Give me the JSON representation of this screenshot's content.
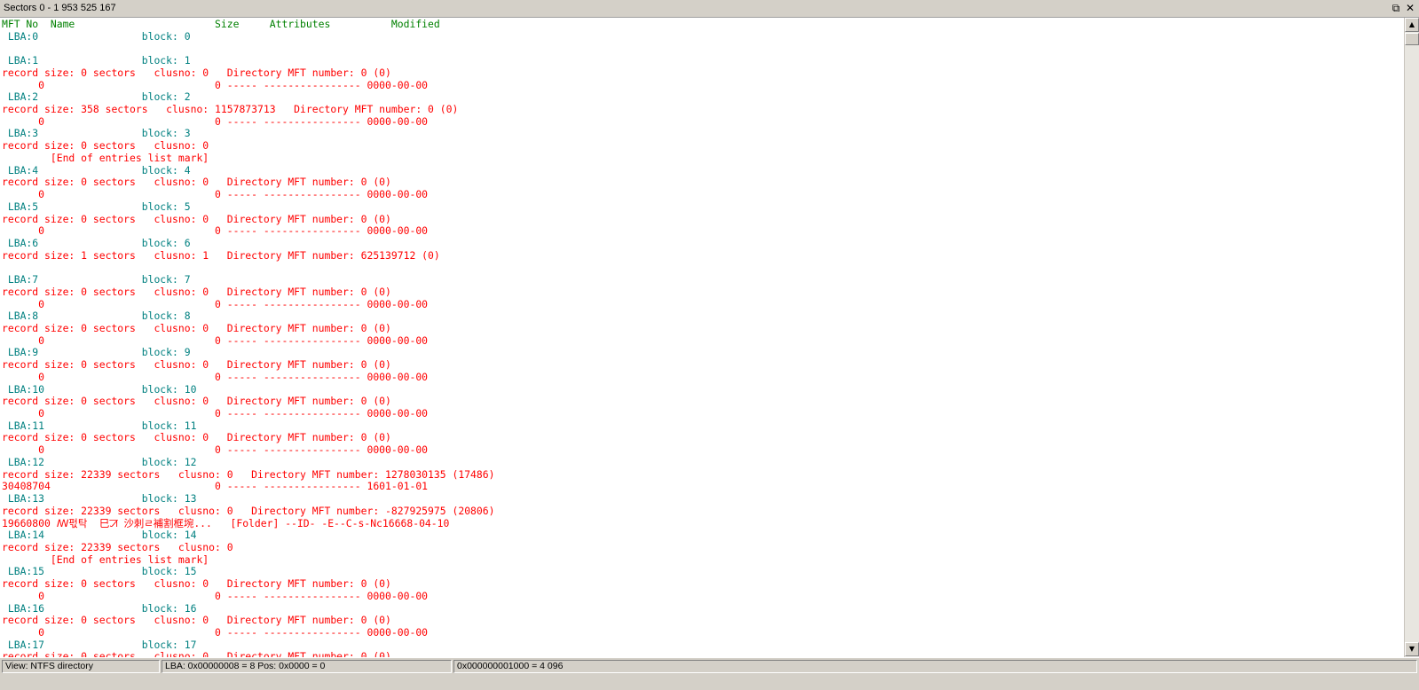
{
  "window": {
    "title": "Sectors 0 - 1 953 525 167",
    "restore_icon": "restore-icon",
    "close_icon": "close-icon"
  },
  "header": {
    "text": "MFT No  Name                       Size     Attributes          Modified"
  },
  "lines": [
    {
      "c": "lba",
      "t": " LBA:0                 block: 0"
    },
    {
      "c": "red",
      "t": ""
    },
    {
      "c": "lba",
      "t": " LBA:1                 block: 1"
    },
    {
      "c": "red",
      "t": "record size: 0 sectors   clusno: 0   Directory MFT number: 0 (0)"
    },
    {
      "c": "red",
      "t": "      0                            0 ----- ---------------- 0000-00-00"
    },
    {
      "c": "lba",
      "t": " LBA:2                 block: 2"
    },
    {
      "c": "red",
      "t": "record size: 358 sectors   clusno: 1157873713   Directory MFT number: 0 (0)"
    },
    {
      "c": "red",
      "t": "      0                            0 ----- ---------------- 0000-00-00"
    },
    {
      "c": "lba",
      "t": " LBA:3                 block: 3"
    },
    {
      "c": "red",
      "t": "record size: 0 sectors   clusno: 0"
    },
    {
      "c": "red",
      "t": "        [End of entries list mark]"
    },
    {
      "c": "lba",
      "t": " LBA:4                 block: 4"
    },
    {
      "c": "red",
      "t": "record size: 0 sectors   clusno: 0   Directory MFT number: 0 (0)"
    },
    {
      "c": "red",
      "t": "      0                            0 ----- ---------------- 0000-00-00"
    },
    {
      "c": "lba",
      "t": " LBA:5                 block: 5"
    },
    {
      "c": "red",
      "t": "record size: 0 sectors   clusno: 0   Directory MFT number: 0 (0)"
    },
    {
      "c": "red",
      "t": "      0                            0 ----- ---------------- 0000-00-00"
    },
    {
      "c": "lba",
      "t": " LBA:6                 block: 6"
    },
    {
      "c": "red",
      "t": "record size: 1 sectors   clusno: 1   Directory MFT number: 625139712 (0)"
    },
    {
      "c": "red",
      "t": ""
    },
    {
      "c": "lba",
      "t": " LBA:7                 block: 7"
    },
    {
      "c": "red",
      "t": "record size: 0 sectors   clusno: 0   Directory MFT number: 0 (0)"
    },
    {
      "c": "red",
      "t": "      0                            0 ----- ---------------- 0000-00-00"
    },
    {
      "c": "lba",
      "t": " LBA:8                 block: 8"
    },
    {
      "c": "red",
      "t": "record size: 0 sectors   clusno: 0   Directory MFT number: 0 (0)"
    },
    {
      "c": "red",
      "t": "      0                            0 ----- ---------------- 0000-00-00"
    },
    {
      "c": "lba",
      "t": " LBA:9                 block: 9"
    },
    {
      "c": "red",
      "t": "record size: 0 sectors   clusno: 0   Directory MFT number: 0 (0)"
    },
    {
      "c": "red",
      "t": "      0                            0 ----- ---------------- 0000-00-00"
    },
    {
      "c": "lba",
      "t": " LBA:10                block: 10"
    },
    {
      "c": "red",
      "t": "record size: 0 sectors   clusno: 0   Directory MFT number: 0 (0)"
    },
    {
      "c": "red",
      "t": "      0                            0 ----- ---------------- 0000-00-00"
    },
    {
      "c": "lba",
      "t": " LBA:11                block: 11"
    },
    {
      "c": "red",
      "t": "record size: 0 sectors   clusno: 0   Directory MFT number: 0 (0)"
    },
    {
      "c": "red",
      "t": "      0                            0 ----- ---------------- 0000-00-00"
    },
    {
      "c": "lba",
      "t": " LBA:12                block: 12"
    },
    {
      "c": "red",
      "t": "record size: 22339 sectors   clusno: 0   Directory MFT number: 1278030135 (17486)"
    },
    {
      "c": "red",
      "t": "30408704                           0 ----- ---------------- 1601-01-01"
    },
    {
      "c": "lba",
      "t": " LBA:13                block: 13"
    },
    {
      "c": "red",
      "t": "record size: 22339 sectors   clusno: 0   Directory MFT number: -827925975 (20806)"
    },
    {
      "c": "red",
      "t": "19660800 ꟿ퍿탁  巳ꠀ 沙刺ㄹ補割框埦...   [Folder] --ID- -E--C-s-Nc16668-04-10"
    },
    {
      "c": "lba",
      "t": " LBA:14                block: 14"
    },
    {
      "c": "red",
      "t": "record size: 22339 sectors   clusno: 0"
    },
    {
      "c": "red",
      "t": "        [End of entries list mark]"
    },
    {
      "c": "lba",
      "t": " LBA:15                block: 15"
    },
    {
      "c": "red",
      "t": "record size: 0 sectors   clusno: 0   Directory MFT number: 0 (0)"
    },
    {
      "c": "red",
      "t": "      0                            0 ----- ---------------- 0000-00-00"
    },
    {
      "c": "lba",
      "t": " LBA:16                block: 16"
    },
    {
      "c": "red",
      "t": "record size: 0 sectors   clusno: 0   Directory MFT number: 0 (0)"
    },
    {
      "c": "red",
      "t": "      0                            0 ----- ---------------- 0000-00-00"
    },
    {
      "c": "lba",
      "t": " LBA:17                block: 17"
    },
    {
      "c": "red",
      "t": "record size: 0 sectors   clusno: 0   Directory MFT number: 0 (0)"
    }
  ],
  "scrollbar": {
    "up_icon": "arrow-up-icon",
    "down_icon": "arrow-down-icon",
    "up_glyph": "▲",
    "down_glyph": "▼"
  },
  "status": {
    "view": "View: NTFS directory",
    "lba": "LBA: 0x00000008 = 8  Pos: 0x0000 = 0",
    "value": "0x000000001000 = 4 096"
  }
}
